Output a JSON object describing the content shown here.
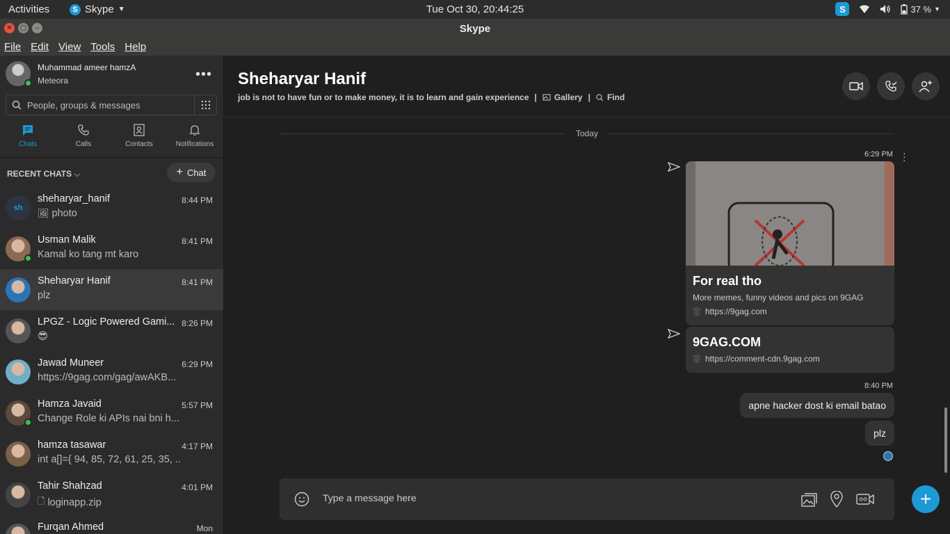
{
  "system_bar": {
    "activities": "Activities",
    "app_name": "Skype",
    "clock": "Tue Oct 30, 20:44:25",
    "battery": "37 %"
  },
  "window": {
    "title": "Skype"
  },
  "menu": {
    "file": "File",
    "edit": "Edit",
    "view": "View",
    "tools": "Tools",
    "help": "Help"
  },
  "profile": {
    "name": "Muhammad ameer hamzA",
    "status": "Meteora"
  },
  "search": {
    "placeholder": "People, groups & messages"
  },
  "nav": {
    "chats": "Chats",
    "calls": "Calls",
    "contacts": "Contacts",
    "notifications": "Notifications"
  },
  "recent_chats_label": "RECENT CHATS",
  "new_chat_label": "Chat",
  "chats": [
    {
      "name": "sheharyar_hanif",
      "time": "8:44 PM",
      "preview": "photo",
      "initials": "sh",
      "online": false,
      "selected": false,
      "avatar_color": "#2b3440",
      "preview_icon": "image-icon"
    },
    {
      "name": "Usman Malik",
      "time": "8:41 PM",
      "preview": "Kamal ko tang mt karo",
      "online": true,
      "selected": false,
      "avatar_color": "#8a6a55"
    },
    {
      "name": "Sheharyar Hanif",
      "time": "8:41 PM",
      "preview": "plz",
      "online": false,
      "selected": true,
      "avatar_color": "#2a74b8"
    },
    {
      "name": "LPGZ - Logic Powered Gami...",
      "time": "8:26 PM",
      "preview": "😎",
      "online": false,
      "selected": false,
      "avatar_color": "#555"
    },
    {
      "name": "Jawad Muneer",
      "time": "6:29 PM",
      "preview": "https://9gag.com/gag/awAKB...",
      "online": false,
      "selected": false,
      "avatar_color": "#6fb0c8"
    },
    {
      "name": "Hamza Javaid",
      "time": "5:57 PM",
      "preview": "Change Role ki APIs nai bni h...",
      "online": true,
      "selected": false,
      "avatar_color": "#5a4a3a"
    },
    {
      "name": "hamza tasawar",
      "time": "4:17 PM",
      "preview": "int a[]={ 94, 85, 72, 61, 25, 35, ...",
      "online": false,
      "selected": false,
      "avatar_color": "#7a6048"
    },
    {
      "name": "Tahir Shahzad",
      "time": "4:01 PM",
      "preview": "loginapp.zip",
      "online": false,
      "selected": false,
      "avatar_color": "#444",
      "preview_icon": "file-icon"
    },
    {
      "name": "Furqan Ahmed",
      "time": "Mon",
      "preview": "",
      "online": false,
      "selected": false,
      "avatar_color": "#555"
    }
  ],
  "conversation": {
    "name": "Sheharyar Hanif",
    "mood": "job is not to have fun or to make money, it is to learn and gain experience",
    "gallery": "Gallery",
    "find": "Find",
    "separator": "|",
    "today_label": "Today",
    "time_1": "6:29 PM",
    "card_1": {
      "title": "For real tho",
      "desc": "More memes, funny videos and pics on 9GAG",
      "url": "https://9gag.com"
    },
    "card_2": {
      "title": "9GAG.COM",
      "url": "https://comment-cdn.9gag.com"
    },
    "time_2": "8:40 PM",
    "msg_1": "apne hacker dost ki email batao",
    "msg_2": "plz"
  },
  "composer": {
    "placeholder": "Type a message here"
  },
  "colors": {
    "accent": "#1c9ad6",
    "online": "#3bc44b",
    "background": "#1f1f1f",
    "sidebar": "#2b2b2b"
  }
}
